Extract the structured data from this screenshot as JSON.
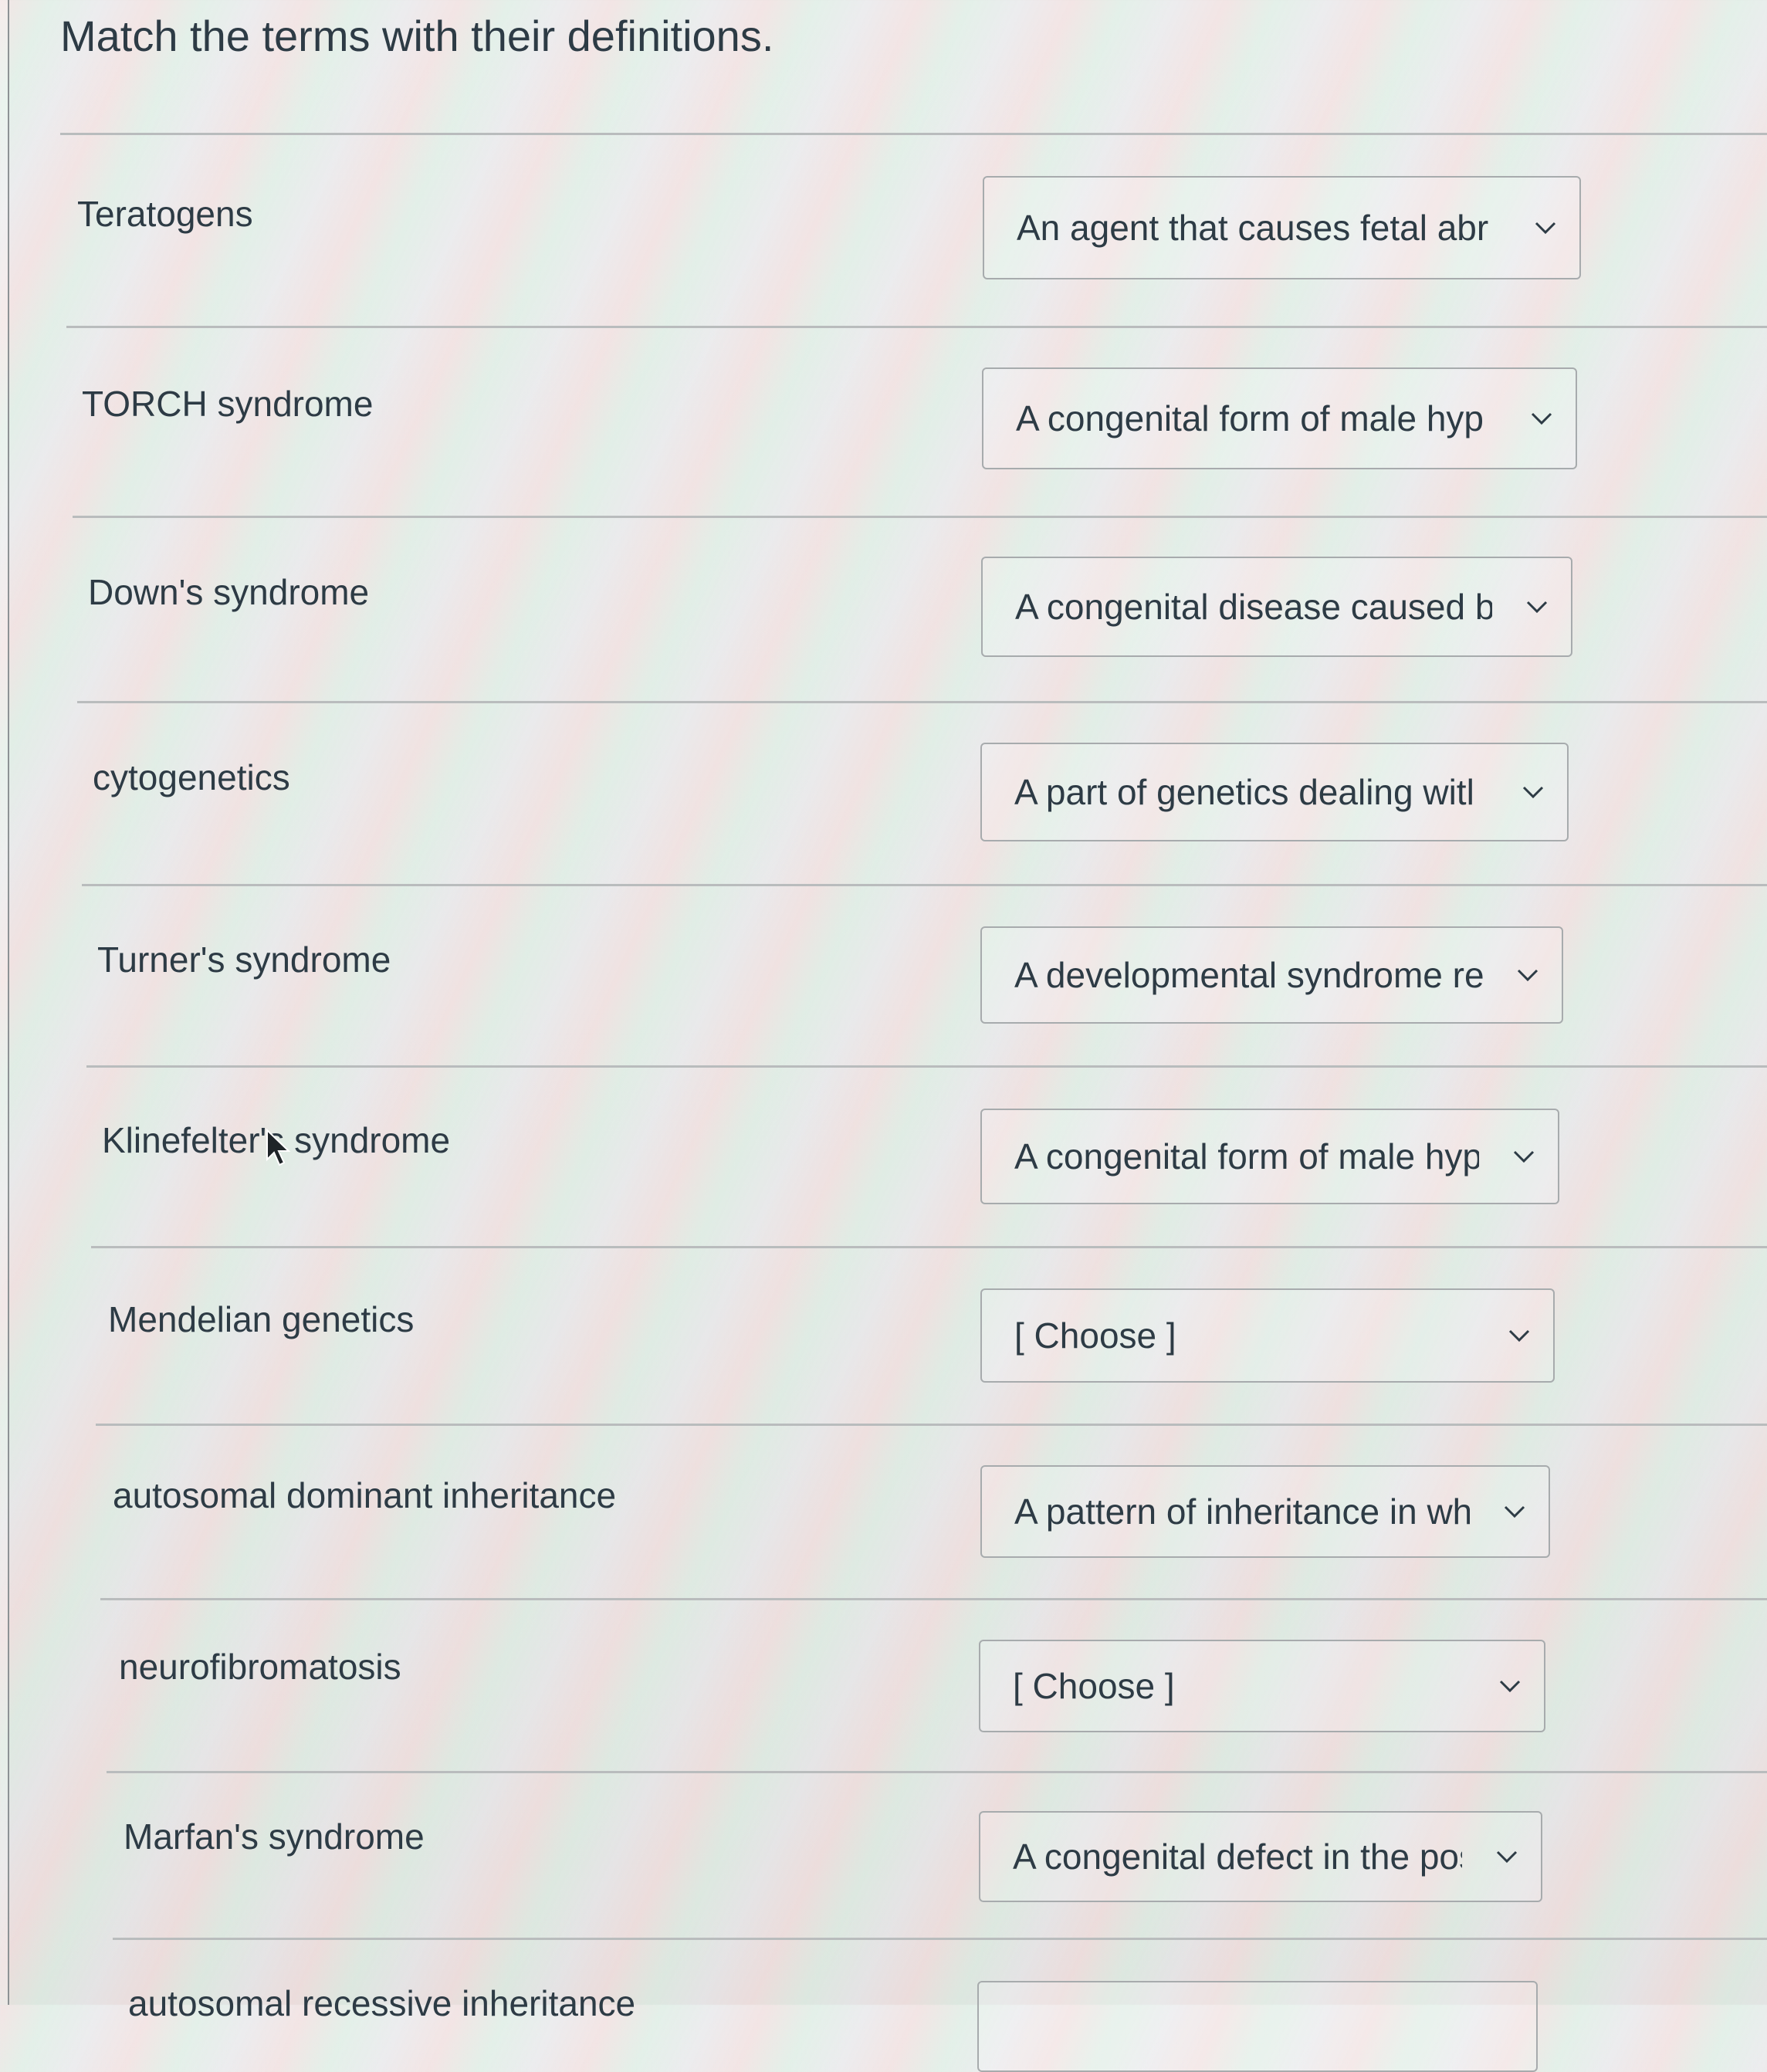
{
  "question": {
    "title": "Match the terms with their definitions."
  },
  "rows": [
    {
      "term": "Teratogens",
      "selected": "An agent that causes fetal abr"
    },
    {
      "term": "TORCH syndrome",
      "selected": "A congenital form of male hyp"
    },
    {
      "term": "Down's syndrome",
      "selected": "A congenital disease caused b"
    },
    {
      "term": "cytogenetics",
      "selected": "A part of genetics dealing witl"
    },
    {
      "term": "Turner's syndrome",
      "selected": "A developmental syndrome re"
    },
    {
      "term": "Klinefelter's syndrome",
      "selected": "A congenital form of male hyp"
    },
    {
      "term": "Mendelian genetics",
      "selected": "[ Choose ]"
    },
    {
      "term": "autosomal dominant inheritance",
      "selected": "A pattern of inheritance in wh"
    },
    {
      "term": "neurofibromatosis",
      "selected": "[ Choose ]"
    },
    {
      "term": "Marfan's syndrome",
      "selected": "A congenital defect in the pos"
    },
    {
      "term": "autosomal recessive inheritance",
      "selected": ""
    }
  ],
  "icons": {
    "dropdown": "chevron-down-icon",
    "pointer": "mouse-pointer-icon"
  }
}
